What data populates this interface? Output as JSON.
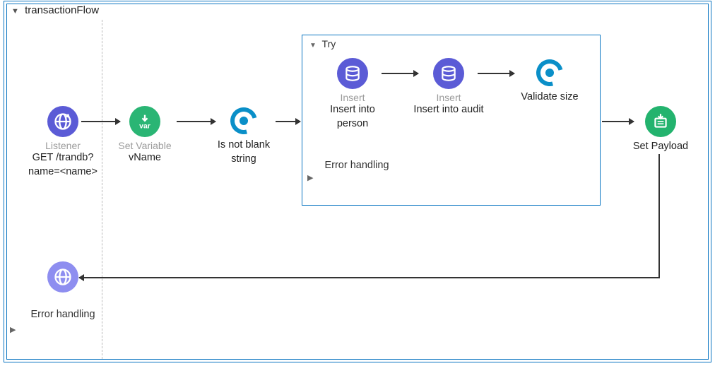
{
  "flow": {
    "title": "transactionFlow",
    "nodes": {
      "listener": {
        "subtype": "Listener",
        "label": "GET /trandb?name=<name>"
      },
      "setVariable": {
        "subtype": "Set Variable",
        "label": "vName"
      },
      "isNotBlank": {
        "subtype": "",
        "label": "Is not blank string"
      },
      "setPayload": {
        "subtype": "",
        "label": "Set Payload"
      }
    },
    "tryScope": {
      "title": "Try",
      "nodes": {
        "insertPerson": {
          "subtype": "Insert",
          "label": "Insert into person"
        },
        "insertAudit": {
          "subtype": "Insert",
          "label": "Insert into audit"
        },
        "validateSize": {
          "subtype": "",
          "label": "Validate size"
        }
      },
      "errorHandling": {
        "label": "Error handling"
      }
    },
    "errorHandling": {
      "label": "Error handling"
    }
  }
}
